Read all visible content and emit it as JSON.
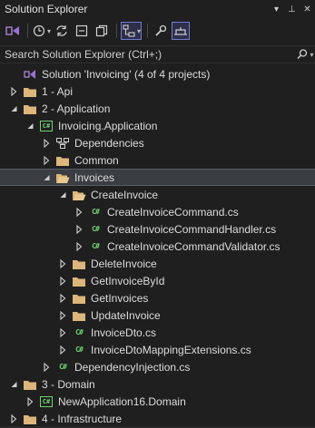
{
  "window": {
    "title": "Solution Explorer",
    "controls": [
      "▾",
      "⊥",
      "✕"
    ]
  },
  "search": {
    "placeholder": "Search Solution Explorer (Ctrl+;)"
  },
  "tree": [
    {
      "label": "Solution 'Invoicing' (4 of 4 projects)",
      "icon": "solution-icon",
      "depth": 0,
      "toggle": "none"
    },
    {
      "label": "1 - Api",
      "icon": "folder-icon",
      "depth": 0,
      "toggle": "collapsed"
    },
    {
      "label": "2 - Application",
      "icon": "folder-icon",
      "depth": 0,
      "toggle": "expanded"
    },
    {
      "label": "Invoicing.Application",
      "icon": "csproj-icon",
      "depth": 1,
      "toggle": "expanded"
    },
    {
      "label": "Dependencies",
      "icon": "dependencies-icon",
      "depth": 2,
      "toggle": "collapsed"
    },
    {
      "label": "Common",
      "icon": "folder-icon",
      "depth": 2,
      "toggle": "collapsed"
    },
    {
      "label": "Invoices",
      "icon": "folder-open-icon",
      "depth": 2,
      "toggle": "expanded",
      "selected": true
    },
    {
      "label": "CreateInvoice",
      "icon": "folder-open-icon",
      "depth": 3,
      "toggle": "expanded"
    },
    {
      "label": "CreateInvoiceCommand.cs",
      "icon": "csharp-icon",
      "depth": 4,
      "toggle": "collapsed"
    },
    {
      "label": "CreateInvoiceCommandHandler.cs",
      "icon": "csharp-icon",
      "depth": 4,
      "toggle": "collapsed"
    },
    {
      "label": "CreateInvoiceCommandValidator.cs",
      "icon": "csharp-icon",
      "depth": 4,
      "toggle": "collapsed"
    },
    {
      "label": "DeleteInvoice",
      "icon": "folder-icon",
      "depth": 3,
      "toggle": "collapsed"
    },
    {
      "label": "GetInvoiceById",
      "icon": "folder-icon",
      "depth": 3,
      "toggle": "collapsed"
    },
    {
      "label": "GetInvoices",
      "icon": "folder-icon",
      "depth": 3,
      "toggle": "collapsed"
    },
    {
      "label": "UpdateInvoice",
      "icon": "folder-icon",
      "depth": 3,
      "toggle": "collapsed"
    },
    {
      "label": "InvoiceDto.cs",
      "icon": "csharp-icon",
      "depth": 3,
      "toggle": "collapsed"
    },
    {
      "label": "InvoiceDtoMappingExtensions.cs",
      "icon": "csharp-icon",
      "depth": 3,
      "toggle": "collapsed"
    },
    {
      "label": "DependencyInjection.cs",
      "icon": "csharp-icon",
      "depth": 2,
      "toggle": "collapsed"
    },
    {
      "label": "3 - Domain",
      "icon": "folder-icon",
      "depth": 0,
      "toggle": "expanded"
    },
    {
      "label": "NewApplication16.Domain",
      "icon": "csproj-icon",
      "depth": 1,
      "toggle": "collapsed"
    },
    {
      "label": "4 - Infrastructure",
      "icon": "folder-icon",
      "depth": 0,
      "toggle": "collapsed"
    }
  ],
  "colors": {
    "folder": "#dcb67a",
    "csharp": "#6fd46f",
    "accent": "#6f7bd1",
    "background": "#1f1f1f",
    "selection": "#3a3d41"
  }
}
